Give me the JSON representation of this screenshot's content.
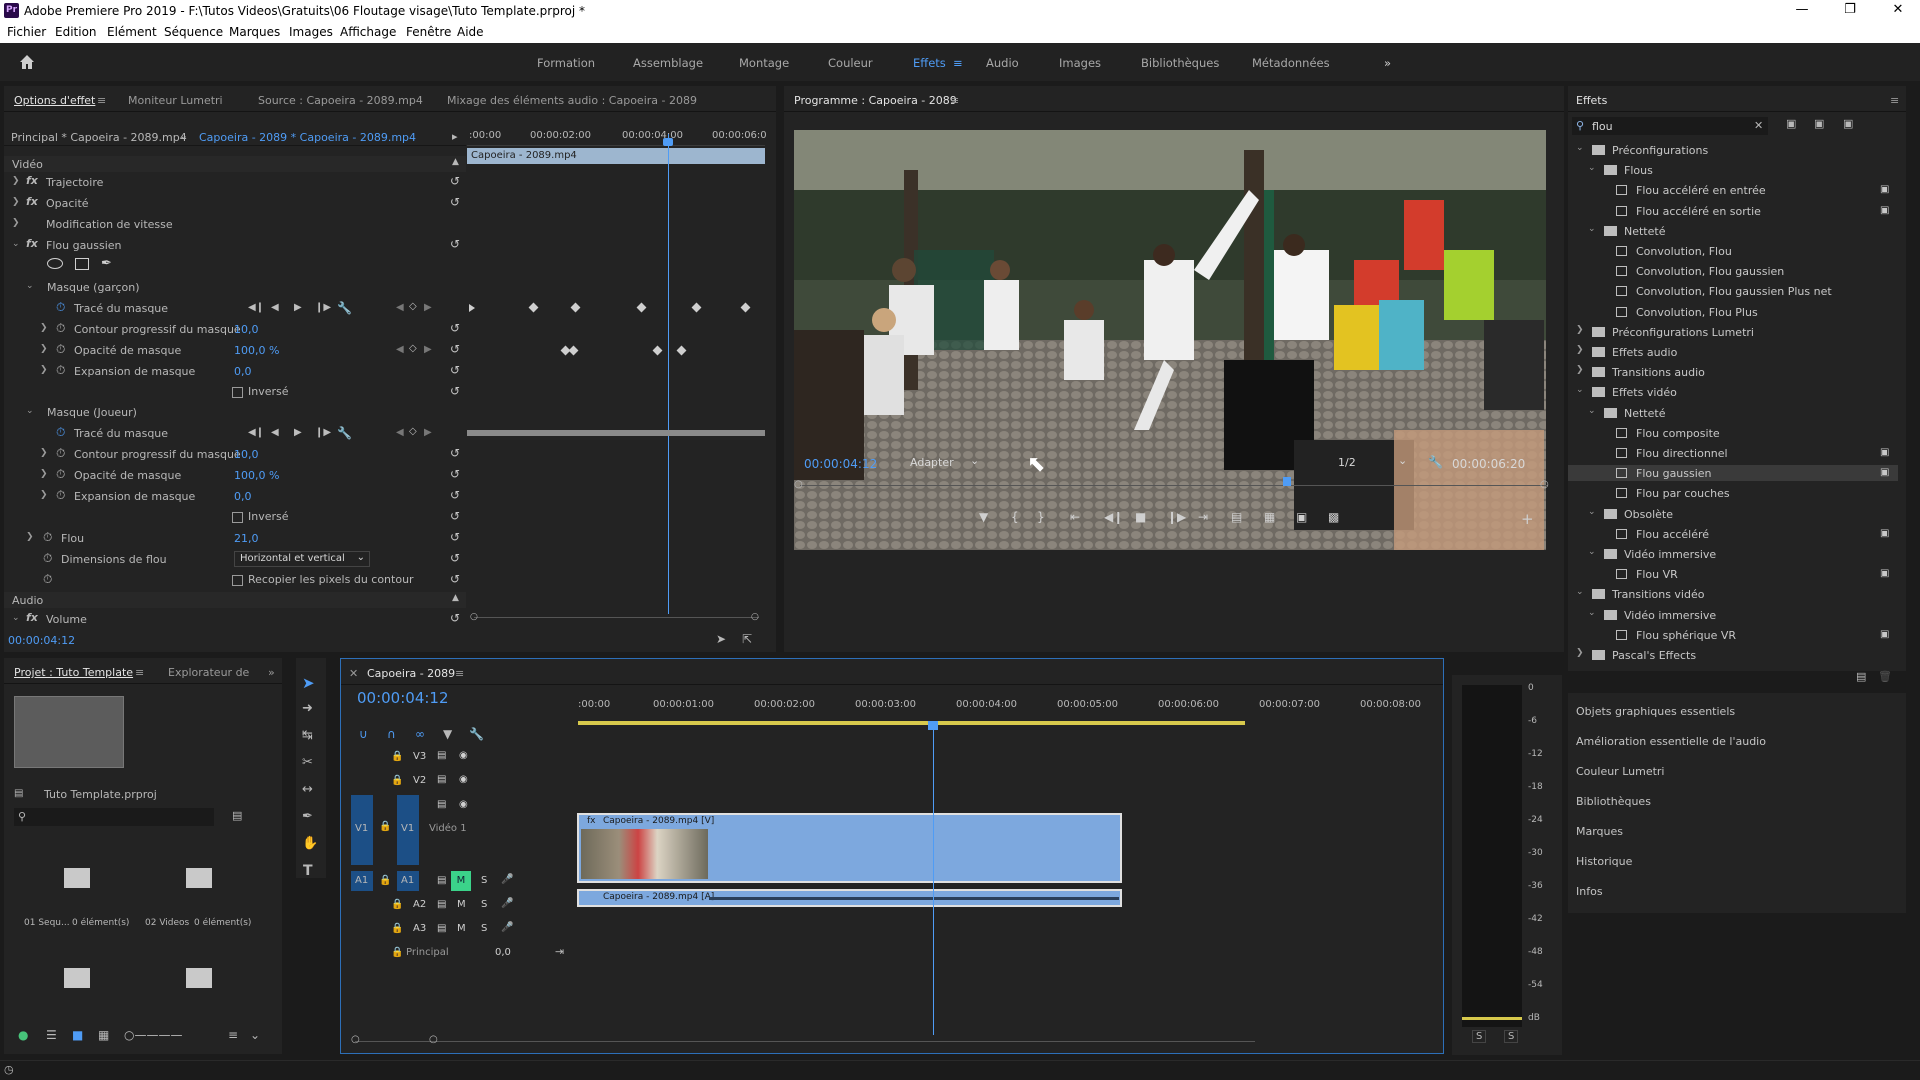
{
  "window": {
    "title": "Adobe Premiere Pro 2019 - F:\\Tutos Videos\\Gratuits\\06 Floutage visage\\Tuto Template.prproj *",
    "icon": "Pr"
  },
  "menu": [
    "Fichier",
    "Edition",
    "Elément",
    "Séquence",
    "Marques",
    "Images",
    "Affichage",
    "Fenêtre",
    "Aide"
  ],
  "workspaces": [
    "Formation",
    "Assemblage",
    "Montage",
    "Couleur",
    "Effets",
    "Audio",
    "Images",
    "Bibliothèques",
    "Métadonnées"
  ],
  "effect_controls": {
    "tabs": [
      "Options d'effet",
      "Moniteur Lumetri",
      "Source : Capoeira - 2089.mp4",
      "Mixage des éléments audio : Capoeira - 2089"
    ],
    "master": "Principal * Capoeira - 2089.mp4",
    "clip": "Capoeira - 2089 * Capoeira - 2089.mp4",
    "mini_ruler": [
      ":00:00",
      "00:00:02:00",
      "00:00:04:00",
      "00:00:06:0"
    ],
    "clip_bar": "Capoeira - 2089.mp4",
    "section_video": "Vidéo",
    "section_audio": "Audio",
    "timecode": "00:00:04:12",
    "rows": {
      "trajectoire": "Trajectoire",
      "opacite": "Opacité",
      "vitesse": "Modification de vitesse",
      "flou_gaussien": "Flou gaussien",
      "masque1": "Masque (garçon)",
      "trace1": "Tracé du masque",
      "contour1": "Contour progressif du masque",
      "contour1_val": "10,0",
      "opac1": "Opacité de masque",
      "opac1_val": "100,0 %",
      "exp1": "Expansion de masque",
      "exp1_val": "0,0",
      "inverse1": "Inversé",
      "masque2": "Masque (Joueur)",
      "trace2": "Tracé du masque",
      "contour2": "Contour progressif du masque",
      "contour2_val": "10,0",
      "opac2": "Opacité de masque",
      "opac2_val": "100,0 %",
      "exp2": "Expansion de masque",
      "exp2_val": "0,0",
      "inverse2": "Inversé",
      "flou": "Flou",
      "flou_val": "21,0",
      "dim": "Dimensions de flou",
      "dim_val": "Horizontal et vertical",
      "recopier": "Recopier les pixels du contour",
      "volume": "Volume"
    }
  },
  "program": {
    "title": "Programme : Capoeira - 2089",
    "timecode": "00:00:04:12",
    "fit": "Adapter",
    "res": "1/2",
    "duration": "00:00:06:20"
  },
  "effects_panel": {
    "title": "Effets",
    "search": "flou",
    "items": [
      {
        "label": "Préconfigurations",
        "lvl": 0,
        "type": "folder",
        "open": true
      },
      {
        "label": "Flous",
        "lvl": 1,
        "type": "folder",
        "open": true
      },
      {
        "label": "Flou accéléré en entrée",
        "lvl": 2,
        "type": "file",
        "acc": true
      },
      {
        "label": "Flou accéléré en sortie",
        "lvl": 2,
        "type": "file",
        "acc": true
      },
      {
        "label": "Netteté",
        "lvl": 1,
        "type": "folder",
        "open": true
      },
      {
        "label": "Convolution, Flou",
        "lvl": 2,
        "type": "file"
      },
      {
        "label": "Convolution, Flou gaussien",
        "lvl": 2,
        "type": "file"
      },
      {
        "label": "Convolution, Flou gaussien Plus net",
        "lvl": 2,
        "type": "file"
      },
      {
        "label": "Convolution, Flou Plus",
        "lvl": 2,
        "type": "file"
      },
      {
        "label": "Préconfigurations Lumetri",
        "lvl": 0,
        "type": "folder"
      },
      {
        "label": "Effets audio",
        "lvl": 0,
        "type": "folder"
      },
      {
        "label": "Transitions audio",
        "lvl": 0,
        "type": "folder"
      },
      {
        "label": "Effets vidéo",
        "lvl": 0,
        "type": "folder",
        "open": true
      },
      {
        "label": "Netteté",
        "lvl": 1,
        "type": "folder",
        "open": true
      },
      {
        "label": "Flou composite",
        "lvl": 2,
        "type": "file"
      },
      {
        "label": "Flou directionnel",
        "lvl": 2,
        "type": "file",
        "acc": true
      },
      {
        "label": "Flou gaussien",
        "lvl": 2,
        "type": "file",
        "acc": true,
        "selected": true
      },
      {
        "label": "Flou par couches",
        "lvl": 2,
        "type": "file"
      },
      {
        "label": "Obsolète",
        "lvl": 1,
        "type": "folder",
        "open": true
      },
      {
        "label": "Flou accéléré",
        "lvl": 2,
        "type": "file",
        "acc": true
      },
      {
        "label": "Vidéo immersive",
        "lvl": 1,
        "type": "folder",
        "open": true
      },
      {
        "label": "Flou VR",
        "lvl": 2,
        "type": "file",
        "acc": true
      },
      {
        "label": "Transitions vidéo",
        "lvl": 0,
        "type": "folder",
        "open": true
      },
      {
        "label": "Vidéo immersive",
        "lvl": 1,
        "type": "folder",
        "open": true
      },
      {
        "label": "Flou sphérique VR",
        "lvl": 2,
        "type": "file",
        "acc": true
      },
      {
        "label": "Pascal's Effects",
        "lvl": 0,
        "type": "folder"
      }
    ]
  },
  "side_panels": [
    "Objets graphiques essentiels",
    "Amélioration essentielle de l'audio",
    "Couleur Lumetri",
    "Bibliothèques",
    "Marques",
    "Historique",
    "Infos"
  ],
  "project": {
    "tabs": [
      "Projet : Tuto Template",
      "Explorateur de"
    ],
    "file": "Tuto Template.prproj",
    "bins": [
      {
        "name": "01 Sequ...",
        "count": "0 élément(s)"
      },
      {
        "name": "02 Videos",
        "count": "0 élément(s)"
      }
    ]
  },
  "timeline": {
    "tab": "Capoeira - 2089",
    "timecode": "00:00:04:12",
    "ruler": [
      ":00:00",
      "00:00:01:00",
      "00:00:02:00",
      "00:00:03:00",
      "00:00:04:00",
      "00:00:05:00",
      "00:00:06:00",
      "00:00:07:00",
      "00:00:08:00"
    ],
    "video_tracks": [
      "V3",
      "V2",
      "V1"
    ],
    "video_track_name": "Vidéo 1",
    "audio_tracks": [
      "A1",
      "A2",
      "A3"
    ],
    "master_label": "Principal",
    "master_val": "0,0",
    "video_clip": "Capoeira - 2089.mp4 [V]",
    "audio_clip": "Capoeira - 2089.mp4 [A]",
    "src_v": "V1",
    "src_a": "A1"
  },
  "meter": {
    "scale": [
      "0",
      "-6",
      "-12",
      "-18",
      "-24",
      "-30",
      "-36",
      "-42",
      "-48",
      "-54",
      "dB"
    ],
    "solo": [
      "S",
      "S"
    ]
  }
}
